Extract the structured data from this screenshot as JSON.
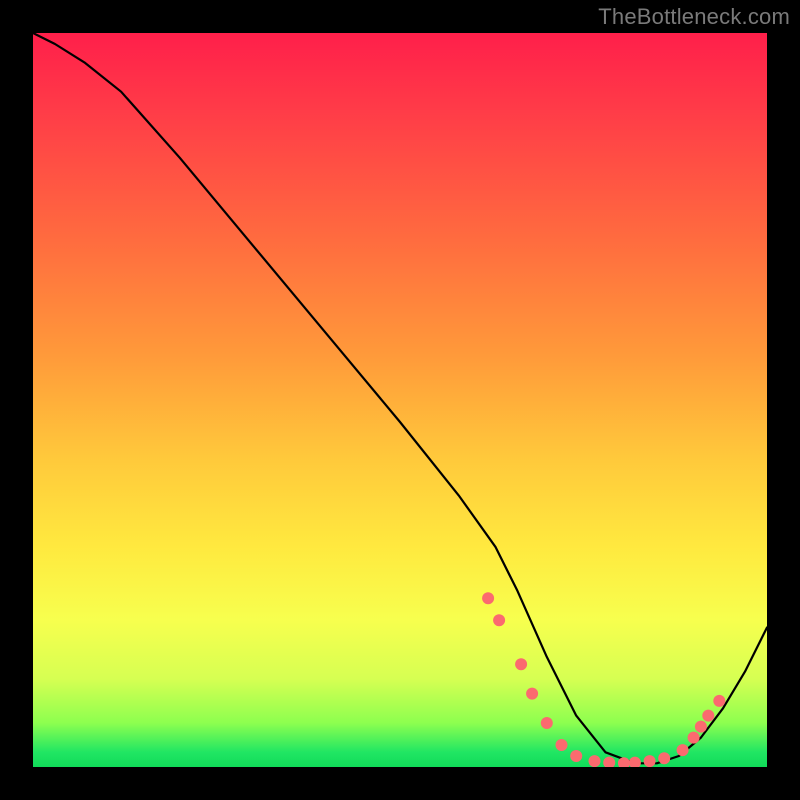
{
  "watermark": "TheBottleneck.com",
  "chart_data": {
    "type": "line",
    "title": "",
    "xlabel": "",
    "ylabel": "",
    "xlim": [
      0,
      100
    ],
    "ylim": [
      0,
      100
    ],
    "series": [
      {
        "name": "curve",
        "x": [
          0,
          3,
          7,
          12,
          20,
          30,
          40,
          50,
          58,
          63,
          66,
          70,
          74,
          78,
          82,
          85,
          88,
          91,
          94,
          97,
          100
        ],
        "y": [
          100,
          98.5,
          96,
          92,
          83,
          71,
          59,
          47,
          37,
          30,
          24,
          15,
          7,
          2,
          0.5,
          0.5,
          1.5,
          4,
          8,
          13,
          19
        ]
      }
    ],
    "markers": [
      {
        "x": 62,
        "y": 23
      },
      {
        "x": 63.5,
        "y": 20
      },
      {
        "x": 66.5,
        "y": 14
      },
      {
        "x": 68,
        "y": 10
      },
      {
        "x": 70,
        "y": 6
      },
      {
        "x": 72,
        "y": 3
      },
      {
        "x": 74,
        "y": 1.5
      },
      {
        "x": 76.5,
        "y": 0.8
      },
      {
        "x": 78.5,
        "y": 0.6
      },
      {
        "x": 80.5,
        "y": 0.5
      },
      {
        "x": 82,
        "y": 0.6
      },
      {
        "x": 84,
        "y": 0.8
      },
      {
        "x": 86,
        "y": 1.2
      },
      {
        "x": 88.5,
        "y": 2.3
      },
      {
        "x": 90,
        "y": 4
      },
      {
        "x": 91,
        "y": 5.5
      },
      {
        "x": 92,
        "y": 7
      },
      {
        "x": 93.5,
        "y": 9
      }
    ],
    "colors": {
      "line": "#000000",
      "marker": "#fb6a6f"
    }
  }
}
